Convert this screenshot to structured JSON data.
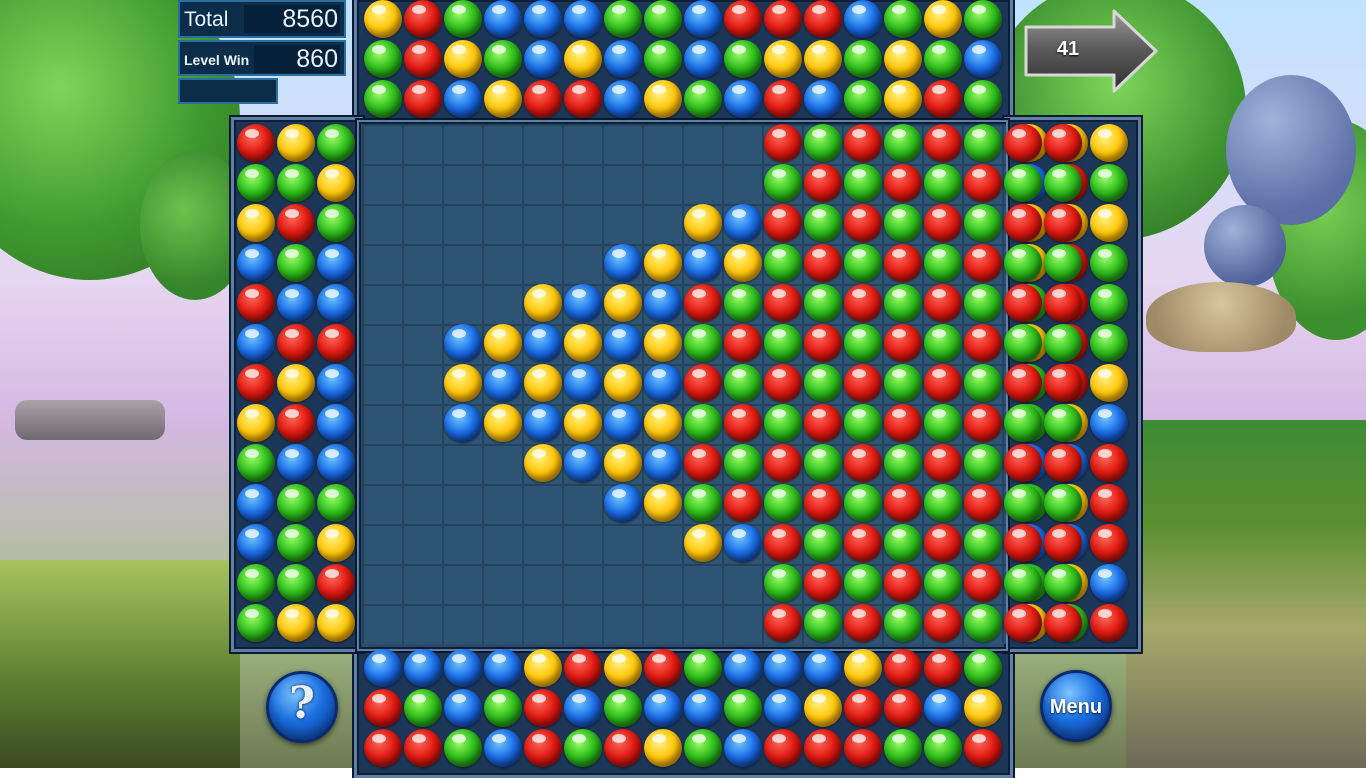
{
  "score_panel": {
    "total_label": "Total",
    "total_value": "8560",
    "level_label": "Level Win",
    "level_value": "860"
  },
  "next_arrow": {
    "count": "41"
  },
  "buttons": {
    "help_glyph": "?",
    "menu_label": "Menu"
  },
  "colors": {
    "R": "#e01b12",
    "G": "#2fbf1c",
    "B": "#1c6fe8",
    "Y": "#ffc80c"
  },
  "boards": {
    "top": [
      "YRGBBBGGBRRRBGYG",
      "GRYGBYBGBGYYGYGB",
      "GRBYRRBYGBRBGYRG"
    ],
    "bottom": [
      "BBBBYRYRGBBBYRRG",
      "RGBGRBGBBGBYRRBY",
      "RRGBRGRYGBRRRGGR"
    ],
    "left": [
      "RYG",
      "GGY",
      "YRG",
      "BGB",
      "RBB",
      "BRR",
      "RYB",
      "YRB",
      "GBB",
      "BGG",
      "BGY",
      "GGR",
      "GYY"
    ],
    "right": [
      "YYY",
      "BRG",
      "YYY",
      "YRG",
      "GRG",
      "YRG",
      "GRY",
      "GYB",
      "BBR",
      "GYR",
      "BBR",
      "GYB",
      "YGR"
    ],
    "center": [
      "..........RGRGRGRR",
      "..........GRGRGRGG",
      "........YBRGRGRGRR",
      "......BYBYGRGRGRGG",
      "....YBYBRGRGRGRGRR",
      "..BYBYBYGRGRGRGRGG",
      "..YBYBYBRGRGRGRGRR",
      "..BYBYBYGRGRGRGRGG",
      "....YBYBRGRGRGRGRR",
      "......BYGRGRGRGRGG",
      "........YBRGRGRGRR",
      "..........GRGRGRGG",
      "..........RGRGRGRR"
    ]
  }
}
